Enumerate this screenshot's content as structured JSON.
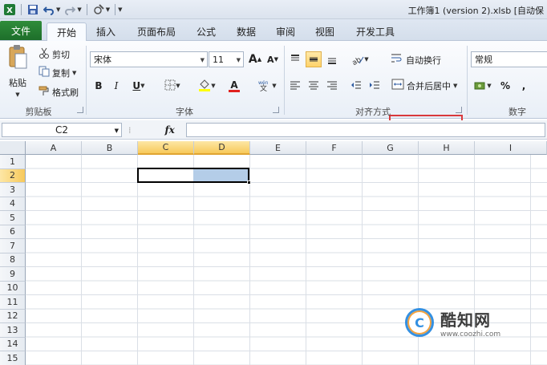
{
  "window": {
    "title": "工作簿1 (version 2).xlsb [自动保"
  },
  "tabs": [
    {
      "label": "文件"
    },
    {
      "label": "开始"
    },
    {
      "label": "插入"
    },
    {
      "label": "页面布局"
    },
    {
      "label": "公式"
    },
    {
      "label": "数据"
    },
    {
      "label": "审阅"
    },
    {
      "label": "视图"
    },
    {
      "label": "开发工具"
    }
  ],
  "clipboard": {
    "paste": "粘贴",
    "cut": "剪切",
    "copy": "复制",
    "format_painter": "格式刷",
    "group": "剪贴板"
  },
  "font": {
    "name": "宋体",
    "size": "11",
    "bold": "B",
    "italic": "I",
    "underline": "U",
    "color_glyph": "A",
    "grow": "A",
    "shrink": "A",
    "group": "字体"
  },
  "alignment": {
    "wrap_text": "自动换行",
    "merge_center": "合并后居中",
    "group": "对齐方式"
  },
  "number": {
    "format": "常规",
    "percent": "%",
    "comma": ",",
    "group": "数字"
  },
  "formula_bar": {
    "name_box": "C2",
    "fx": "fx"
  },
  "sheet": {
    "columns": [
      "A",
      "B",
      "C",
      "D",
      "E",
      "F",
      "G",
      "H",
      "I"
    ],
    "rows": [
      "1",
      "2",
      "3",
      "4",
      "5",
      "6",
      "7",
      "8",
      "9",
      "10",
      "11",
      "12",
      "13",
      "14",
      "15"
    ],
    "selected_columns": [
      "C",
      "D"
    ],
    "selected_row": "2"
  },
  "watermark": {
    "name": "酷知网",
    "url": "www.coozhi.com"
  },
  "colors": {
    "file_tab": "#1d6e2a",
    "highlight": "#d9393c",
    "selection_fill": "#b4cde8",
    "header_selected": "#f7c95a"
  }
}
